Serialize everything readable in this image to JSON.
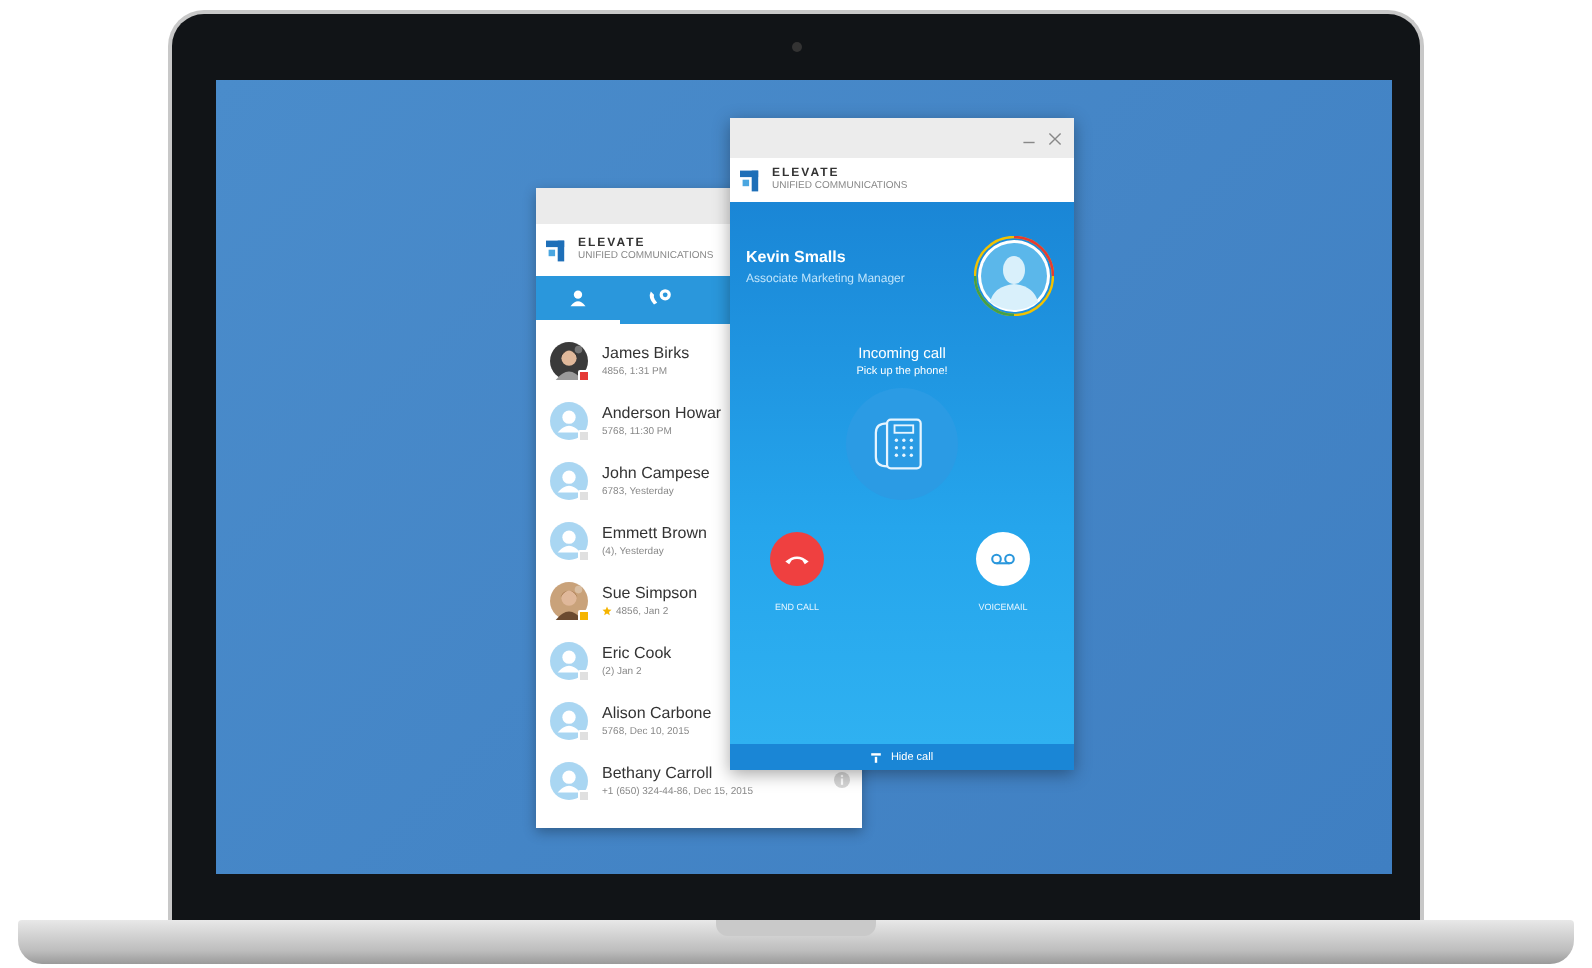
{
  "contacts_window": {
    "logo": {
      "name": "ELEVATE",
      "tagline": "UNIFIED COMMUNICATIONS"
    },
    "tabs": [
      {
        "kind": "contacts",
        "selected": true
      },
      {
        "kind": "calls",
        "selected": false
      }
    ],
    "contacts": [
      {
        "name": "James Birks",
        "detail": "4856, 1:31 PM",
        "starred": false,
        "color": "#e53935"
      },
      {
        "name": "Anderson Howar",
        "detail": "5768, 11:30 PM",
        "kind": "generic",
        "starred": false,
        "color": "#e0e0e0"
      },
      {
        "name": "John Campese",
        "detail": "6783, Yesterday",
        "kind": "generic",
        "starred": false,
        "color": "#e0e0e0"
      },
      {
        "name": "Emmett Brown",
        "detail": "(4), Yesterday",
        "kind": "generic",
        "starred": false,
        "color": "#e0e0e0"
      },
      {
        "name": "Sue Simpson",
        "detail": "4856, Jan 2",
        "starred": true,
        "color": "#f5b400"
      },
      {
        "name": "Eric Cook",
        "detail": "(2) Jan 2",
        "kind": "generic",
        "starred": false,
        "color": "#e0e0e0"
      },
      {
        "name": "Alison Carbone",
        "detail": "5768, Dec 10, 2015",
        "kind": "generic",
        "starred": false,
        "color": "#e0e0e0"
      },
      {
        "name": "Bethany Carroll",
        "detail": "+1 (650) 324-44-86, Dec 15, 2015",
        "kind": "generic",
        "starred": false,
        "color": "#e0e0e0"
      }
    ]
  },
  "call_window": {
    "logo": {
      "name": "ELEVATE",
      "tagline": "UNIFIED COMMUNICATIONS"
    },
    "caller": {
      "name": "Kevin Smalls",
      "title": "Associate Marketing Manager"
    },
    "status": "Incoming call",
    "prompt": "Pick up the phone!",
    "actions": [
      {
        "kind": "end",
        "label": "END CALL"
      },
      {
        "kind": "voicemail",
        "label": "VOICEMAIL"
      }
    ],
    "hide_label": "Hide call"
  }
}
